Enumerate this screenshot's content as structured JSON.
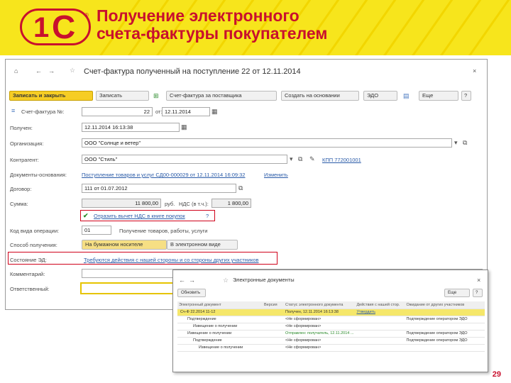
{
  "slide": {
    "title_line1": "Получение электронного",
    "title_line2": "счета-фактуры покупателем",
    "page_number": "29"
  },
  "logo": {
    "text_one": "1",
    "text_c": "С",
    "reg": "®"
  },
  "doc_window": {
    "title": "Счет-фактура полученный на поступление 22 от 12.11.2014",
    "toolbar": {
      "save_close": "Записать и закрыть",
      "save": "Записать",
      "invoice_supplier": "Счет-фактура за поставщика",
      "create_based": "Создать на основании",
      "edo": "ЭДО",
      "more": "Еще",
      "help": "?"
    },
    "fields": {
      "invoice_no_label": "Счет-фактура №:",
      "invoice_no": "22",
      "from_label": "от:",
      "invoice_date": "12.11.2014",
      "received_label": "Получен:",
      "received": "12.11.2014 16:13:38",
      "org_label": "Организация:",
      "org": "ООО \"Солнце и ветер\"",
      "counterparty_label": "Контрагент:",
      "counterparty": "ООО \"Стиль\"",
      "kpp": "КПП 772001001",
      "basis_label": "Документы-основания:",
      "basis": "Поступление товаров и услуг СД00-000029 от 12.11.2014 16:09:32",
      "change": "Изменить",
      "contract_label": "Договор:",
      "contract": "111 от 01.07.2012",
      "sum_label": "Сумма:",
      "sum": "11 800,00",
      "currency": "руб.",
      "vat_label": "НДС (в т.ч.):",
      "vat": "1 800,00",
      "vat_check": "Отразить вычет НДС в книге покупок",
      "vat_help": "?",
      "op_code_label": "Код вида операции:",
      "op_code": "01",
      "op_desc": "Получение товаров, работы, услуги",
      "method_label": "Способ получения:",
      "method_paper": "На бумажном носителе",
      "method_electronic": "В электронном виде",
      "edo_state_label": "Состояние ЭД:",
      "edo_state": "Требуются действия с нашей стороны и со стороны других участников",
      "comment_label": "Комментарий:",
      "responsible_label": "Ответственный:"
    }
  },
  "edo_window": {
    "title": "Электронные документы",
    "refresh": "Обновить",
    "more": "Еще",
    "help": "?",
    "columns": [
      "Электронный документ",
      "Версия",
      "Статус электронного документа",
      "Действия с нашей стор.",
      "Ожидание от других участников"
    ],
    "rows": [
      [
        "Сч-Ф 22.2014 11-12",
        "",
        "Получен, 12.11.2014 16:13:38",
        "Утвердить",
        ""
      ],
      [
        "Подтверждение",
        "",
        "<Не сформирован>",
        "",
        "Подтверждение оператором ЭДО"
      ],
      [
        "Извещение о получении",
        "",
        "<Не сформирован>",
        "",
        ""
      ],
      [
        "Извещение о получении",
        "",
        "Отправлен: получатель, 12.11.2014 ...",
        "",
        "Подтверждение оператором ЭДО"
      ],
      [
        "Подтверждение",
        "",
        "<Не сформирован>",
        "",
        "Подтверждение оператором ЭДО"
      ],
      [
        "Извещение о получении",
        "",
        "<Не сформирован>",
        "",
        ""
      ]
    ]
  }
}
